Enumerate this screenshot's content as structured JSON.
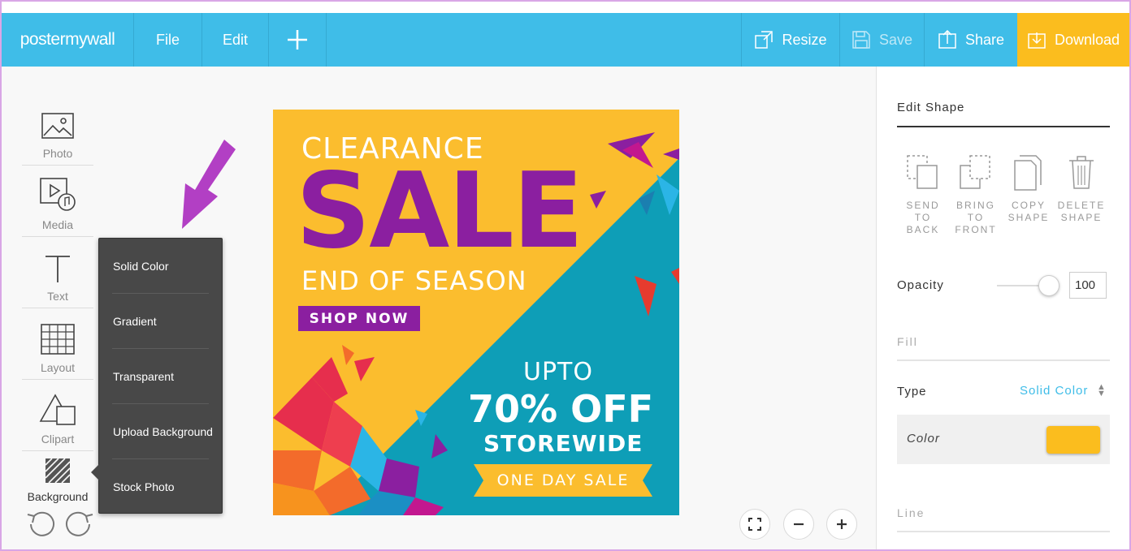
{
  "app": {
    "logo": "postermywall"
  },
  "menu": {
    "file": "File",
    "edit": "Edit",
    "add_icon": "plus-icon"
  },
  "toolbar": {
    "resize": "Resize",
    "save": "Save",
    "share": "Share",
    "download": "Download",
    "accent": "#3fbde8",
    "download_color": "#fbbd1e"
  },
  "tools": [
    {
      "label": "Photo",
      "icon": "photo-icon"
    },
    {
      "label": "Media",
      "icon": "media-icon"
    },
    {
      "label": "Text",
      "icon": "text-icon"
    },
    {
      "label": "Layout",
      "icon": "layout-icon"
    },
    {
      "label": "Clipart",
      "icon": "clipart-icon"
    },
    {
      "label": "Background",
      "icon": "background-icon"
    }
  ],
  "background_menu": [
    "Solid Color",
    "Gradient",
    "Transparent",
    "Upload Background",
    "Stock Photo"
  ],
  "poster": {
    "clearance": "CLEARANCE",
    "sale": "SALE",
    "end_of_season": "END OF SEASON",
    "shop_now": "SHOP NOW",
    "upto": "UPTO",
    "off": "70% OFF",
    "storewide": "STOREWIDE",
    "one_day_sale": "ONE DAY SALE",
    "colors": {
      "yellow": "#fbbd2e",
      "teal": "#0e9eb7",
      "purple": "#8b1fa0"
    }
  },
  "zoom": {
    "fit_icon": "fit-screen-icon",
    "out_icon": "minus-icon",
    "in_icon": "plus-icon"
  },
  "panel": {
    "title": "Edit Shape",
    "actions": [
      {
        "label": "SEND TO BACK",
        "icon": "send-to-back-icon"
      },
      {
        "label": "BRING TO FRONT",
        "icon": "bring-to-front-icon"
      },
      {
        "label": "COPY SHAPE",
        "icon": "copy-icon"
      },
      {
        "label": "DELETE SHAPE",
        "icon": "trash-icon"
      }
    ],
    "opacity_label": "Opacity",
    "opacity_value": "100",
    "opacity_level": 1.0,
    "fill_label": "Fill",
    "type_label": "Type",
    "type_value": "Solid Color",
    "color_label": "Color",
    "color_value": "#fbbd1e",
    "line_label": "Line"
  }
}
